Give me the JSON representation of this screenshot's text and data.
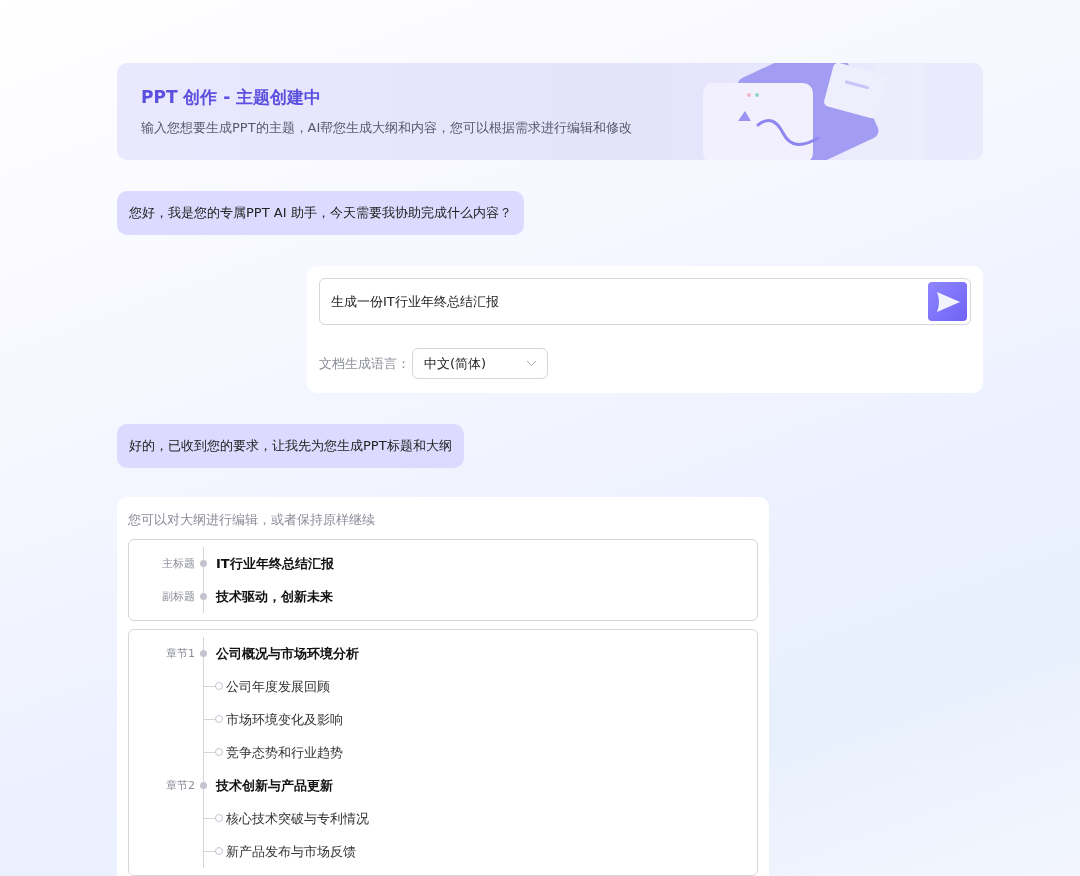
{
  "header": {
    "title": "PPT 创作 - 主题创建中",
    "subtitle": "输入您想要生成PPT的主题，AI帮您生成大纲和内容，您可以根据需求进行编辑和修改"
  },
  "messages": [
    {
      "kind": "bot",
      "text": "您好，我是您的专属PPT AI 助手，今天需要我协助完成什么内容？"
    },
    {
      "kind": "prompt",
      "value": "生成一份IT行业年终总结汇报",
      "language_label": "文档生成语言：",
      "language": "中文(简体)"
    },
    {
      "kind": "bot",
      "text": "好的，已收到您的要求，让我先为您生成PPT标题和大纲"
    },
    {
      "kind": "outline",
      "hint": "您可以对大纲进行编辑，或者保持原样继续",
      "titles": [
        {
          "label": "主标题",
          "text": "IT行业年终总结汇报"
        },
        {
          "label": "副标题",
          "text": "技术驱动，创新未来"
        }
      ],
      "chapters": [
        {
          "label": "章节1",
          "title": "公司概况与市场环境分析",
          "children": [
            {
              "text": "公司年度发展回顾"
            },
            {
              "text": "市场环境变化及影响"
            },
            {
              "text": "竞争态势和行业趋势"
            }
          ]
        },
        {
          "label": "章节2",
          "title": "技术创新与产品更新",
          "children": [
            {
              "text": "核心技术突破与专利情况"
            },
            {
              "text": "新产品发布与市场反馈"
            }
          ]
        }
      ]
    }
  ]
}
